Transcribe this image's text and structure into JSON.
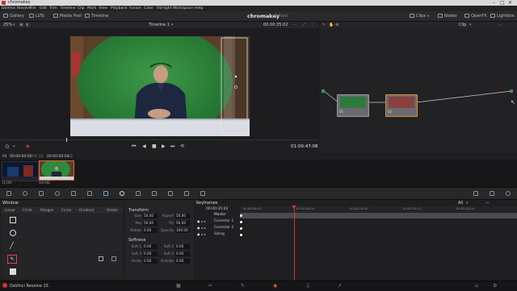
{
  "window": {
    "title": "chromakey"
  },
  "menu": [
    "DaVinci Resolve",
    "File",
    "Edit",
    "Trim",
    "Timeline",
    "Clip",
    "Mark",
    "View",
    "Playback",
    "Fusion",
    "Color",
    "Fairlight",
    "Workspace",
    "Help"
  ],
  "toolbar": {
    "left": [
      "Gallery",
      "LUTs",
      "Media Pool",
      "Timeline"
    ],
    "project_name": "chromakey",
    "project_status": "Edited",
    "right": [
      "Clips",
      "Nodes",
      "OpenFX",
      "Lightbox"
    ]
  },
  "viewer": {
    "zoom": "25%",
    "timeline_name": "Timeline 1",
    "timecode_top": "00:00:35:02",
    "timecode": "01:00:47:08"
  },
  "node_editor": {
    "mode": "Clip",
    "nodes": [
      {
        "label": "01"
      },
      {
        "label": "02"
      }
    ]
  },
  "clip_strip": {
    "clips": [
      {
        "index": "01",
        "timecode": "00:00:00:00",
        "track": "V1",
        "codec": "H.264"
      },
      {
        "index": "02",
        "timecode": "00:00:00:00",
        "track": "V2",
        "codec": "AVCHD"
      }
    ]
  },
  "window_panel": {
    "title": "Window",
    "tools": [
      "Linear",
      "Circle",
      "Polygon",
      "Curve",
      "Gradient"
    ],
    "delete_label": "Delete"
  },
  "transform": {
    "title": "Transform",
    "rows": [
      {
        "label": "Size",
        "value": "50.00",
        "label2": "Aspect",
        "value2": "50.00"
      },
      {
        "label": "Pan",
        "value": "50.00",
        "label2": "Tilt",
        "value2": "50.00"
      },
      {
        "label": "Rotate",
        "value": "0.00",
        "label2": "Opacity",
        "value2": "100.00"
      }
    ],
    "softness_title": "Softness",
    "softness_rows": [
      {
        "label": "Soft 1",
        "value": "0.00",
        "label2": "Soft 2",
        "value2": "0.00"
      },
      {
        "label": "Soft 3",
        "value": "0.00",
        "label2": "Soft 4",
        "value2": "0.00"
      },
      {
        "label": "Inside",
        "value": "0.00",
        "label2": "Outside",
        "value2": "0.00"
      }
    ]
  },
  "keyframes": {
    "title": "Keyframes",
    "filter": "All",
    "current_tc": "00:00:35:02",
    "ruler": [
      "00:00:00:00",
      "00:00:05:04",
      "00:00:10:08",
      "00:00:15:12",
      "00:00:20:16"
    ],
    "tracks": [
      "Master",
      "Corrector 1",
      "Corrector 2",
      "Sizing"
    ]
  },
  "footer": {
    "app_name": "DaVinci Resolve 15"
  },
  "colors": {
    "accent": "#e0662c",
    "playhead": "#d03434",
    "node_select": "#e08e2c"
  }
}
